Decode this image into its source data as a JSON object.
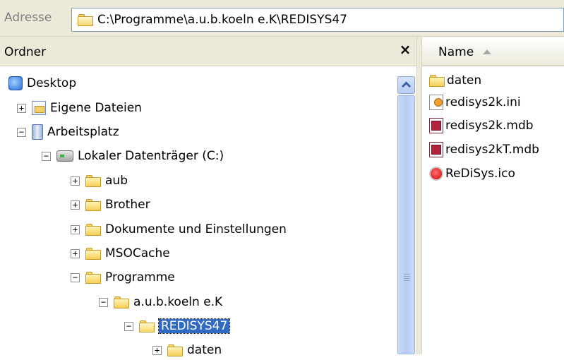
{
  "address_bar": {
    "label": "Adresse",
    "path": "C:\\Programme\\a.u.b.koeln e.K\\REDISYS47"
  },
  "folder_pane": {
    "title": "Ordner",
    "close_glyph": "×",
    "tree": [
      {
        "label": "Desktop",
        "icon": "desktop-icon",
        "expander": ""
      },
      {
        "label": "Eigene Dateien",
        "icon": "my-documents-icon",
        "expander": "+"
      },
      {
        "label": "Arbeitsplatz",
        "icon": "my-computer-icon",
        "expander": "−"
      },
      {
        "label": "Lokaler Datenträger (C:)",
        "icon": "drive-icon",
        "expander": "−"
      },
      {
        "label": "aub",
        "icon": "folder-icon",
        "expander": "+"
      },
      {
        "label": "Brother",
        "icon": "folder-icon",
        "expander": "+"
      },
      {
        "label": "Dokumente und Einstellungen",
        "icon": "folder-icon",
        "expander": "+"
      },
      {
        "label": "MSOCache",
        "icon": "folder-icon",
        "expander": "+"
      },
      {
        "label": "Programme",
        "icon": "folder-icon",
        "expander": "−"
      },
      {
        "label": "a.u.b.koeln e.K",
        "icon": "folder-icon",
        "expander": "−"
      },
      {
        "label": "REDISYS47",
        "icon": "folder-open-icon",
        "expander": "−",
        "selected": true
      },
      {
        "label": "daten",
        "icon": "folder-icon",
        "expander": "+"
      }
    ]
  },
  "file_list": {
    "column_name": "Name",
    "sort": "ascending",
    "files": [
      {
        "label": "daten",
        "icon": "folder-icon"
      },
      {
        "label": "redisys2k.ini",
        "icon": "ini-file-icon"
      },
      {
        "label": "redisys2k.mdb",
        "icon": "access-db-icon"
      },
      {
        "label": "redisys2kT.mdb",
        "icon": "access-db-icon"
      },
      {
        "label": "ReDiSys.ico",
        "icon": "icon-file-icon"
      }
    ]
  },
  "colors": {
    "chrome": "#ece9d8",
    "selection": "#316ac5",
    "address_border": "#7f9db9"
  }
}
